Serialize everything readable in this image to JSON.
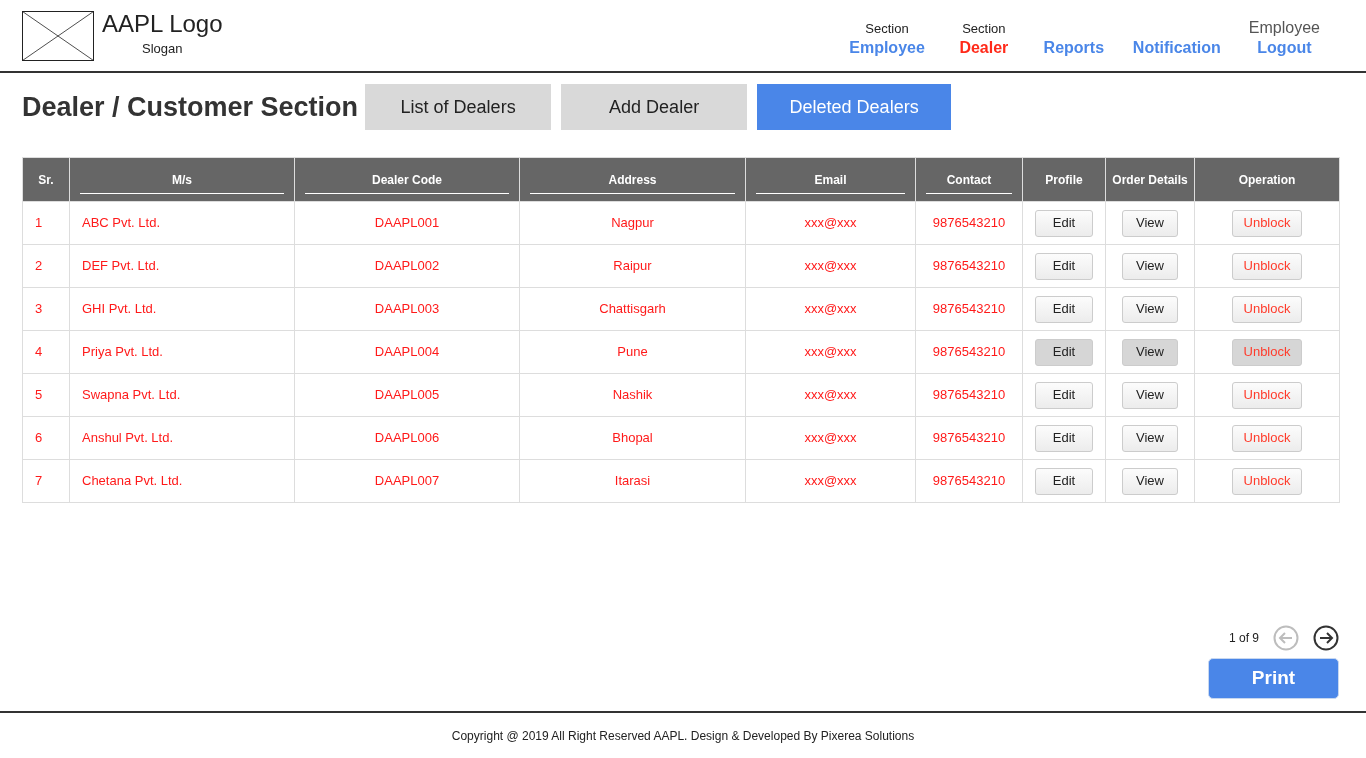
{
  "logo": {
    "title": "AAPL Logo",
    "slogan": "Slogan"
  },
  "nav": [
    {
      "kind": "link",
      "caption": "Section",
      "label": "Employee",
      "selected": false
    },
    {
      "kind": "link",
      "caption": "Section",
      "label": "Dealer",
      "selected": true
    },
    {
      "kind": "link",
      "label": "Reports",
      "selected": false
    },
    {
      "kind": "link",
      "label": "Notification",
      "selected": false
    },
    {
      "kind": "account",
      "caption": "Employee",
      "label": "Logout",
      "selected": false
    }
  ],
  "page_title": "Dealer / Customer Section",
  "tabs": [
    {
      "label": "List of Dealers",
      "selected": false
    },
    {
      "label": "Add Dealer",
      "selected": false
    },
    {
      "label": "Deleted Dealers",
      "selected": true
    }
  ],
  "table": {
    "columns": [
      {
        "label": "Sr.",
        "underline": false
      },
      {
        "label": "M/s",
        "underline": true
      },
      {
        "label": "Dealer Code",
        "underline": true
      },
      {
        "label": "Address",
        "underline": true
      },
      {
        "label": "Email",
        "underline": true
      },
      {
        "label": "Contact",
        "underline": true
      },
      {
        "label": "Profile",
        "underline": false
      },
      {
        "label": "Order Details",
        "underline": false
      },
      {
        "label": "Operation",
        "underline": false
      }
    ],
    "rows": [
      {
        "sr": "1",
        "name": "ABC Pvt. Ltd.",
        "code": "DAAPL001",
        "address": "Nagpur",
        "email": "xxx@xxx",
        "contact": "9876543210",
        "profile": "Edit",
        "order": "View",
        "operation": "Unblock",
        "highlighted": false
      },
      {
        "sr": "2",
        "name": "DEF Pvt. Ltd.",
        "code": "DAAPL002",
        "address": "Raipur",
        "email": "xxx@xxx",
        "contact": "9876543210",
        "profile": "Edit",
        "order": "View",
        "operation": "Unblock",
        "highlighted": false
      },
      {
        "sr": "3",
        "name": "GHI Pvt. Ltd.",
        "code": "DAAPL003",
        "address": "Chattisgarh",
        "email": "xxx@xxx",
        "contact": "9876543210",
        "profile": "Edit",
        "order": "View",
        "operation": "Unblock",
        "highlighted": false
      },
      {
        "sr": "4",
        "name": "Priya Pvt. Ltd.",
        "code": "DAAPL004",
        "address": "Pune",
        "email": "xxx@xxx",
        "contact": "9876543210",
        "profile": "Edit",
        "order": "View",
        "operation": "Unblock",
        "highlighted": true
      },
      {
        "sr": "5",
        "name": "Swapna Pvt. Ltd.",
        "code": "DAAPL005",
        "address": "Nashik",
        "email": "xxx@xxx",
        "contact": "9876543210",
        "profile": "Edit",
        "order": "View",
        "operation": "Unblock",
        "highlighted": false
      },
      {
        "sr": "6",
        "name": "Anshul Pvt. Ltd.",
        "code": "DAAPL006",
        "address": "Bhopal",
        "email": "xxx@xxx",
        "contact": "9876543210",
        "profile": "Edit",
        "order": "View",
        "operation": "Unblock",
        "highlighted": false
      },
      {
        "sr": "7",
        "name": "Chetana Pvt. Ltd.",
        "code": "DAAPL007",
        "address": "Itarasi",
        "email": "xxx@xxx",
        "contact": "9876543210",
        "profile": "Edit",
        "order": "View",
        "operation": "Unblock",
        "highlighted": false
      }
    ]
  },
  "pagination": {
    "text": "1 of 9",
    "prev_disabled": true,
    "next_disabled": false
  },
  "print_button": "Print",
  "footer": "Copyright @ 2019 All Right Reserved AAPL. Design & Developed By Pixerea Solutions"
}
